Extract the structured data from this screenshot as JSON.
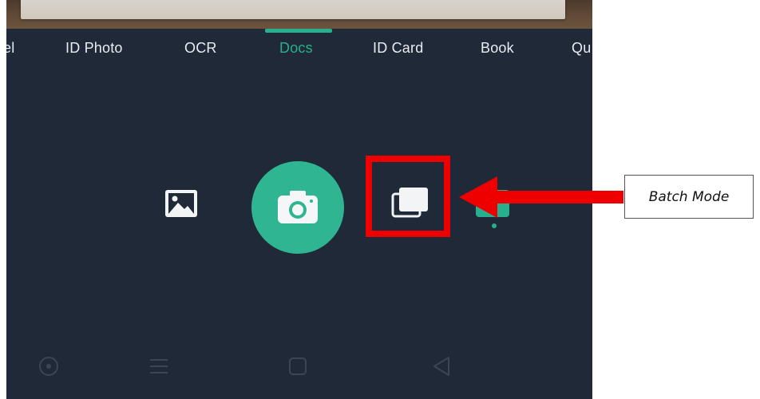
{
  "mode_tabs": {
    "items": [
      {
        "label": "el",
        "active": false
      },
      {
        "label": "ID Photo",
        "active": false
      },
      {
        "label": "OCR",
        "active": false
      },
      {
        "label": "Docs",
        "active": true
      },
      {
        "label": "ID Card",
        "active": false
      },
      {
        "label": "Book",
        "active": false
      },
      {
        "label": "Qu",
        "active": false
      }
    ]
  },
  "toolbar": {
    "gallery_icon": "image-icon",
    "shutter_icon": "camera-icon",
    "batch_icon": "batch-mode-icon",
    "partial_icon": "mode-icon"
  },
  "navbar": {
    "icons": [
      "circle-icon",
      "menu-icon",
      "square-icon",
      "back-triangle-icon"
    ]
  },
  "annotation": {
    "callout_text": "Batch Mode",
    "highlight_color": "#ee0000"
  },
  "colors": {
    "accent": "#28b08e",
    "background": "#1f2937",
    "annotation_red": "#ee0000"
  }
}
